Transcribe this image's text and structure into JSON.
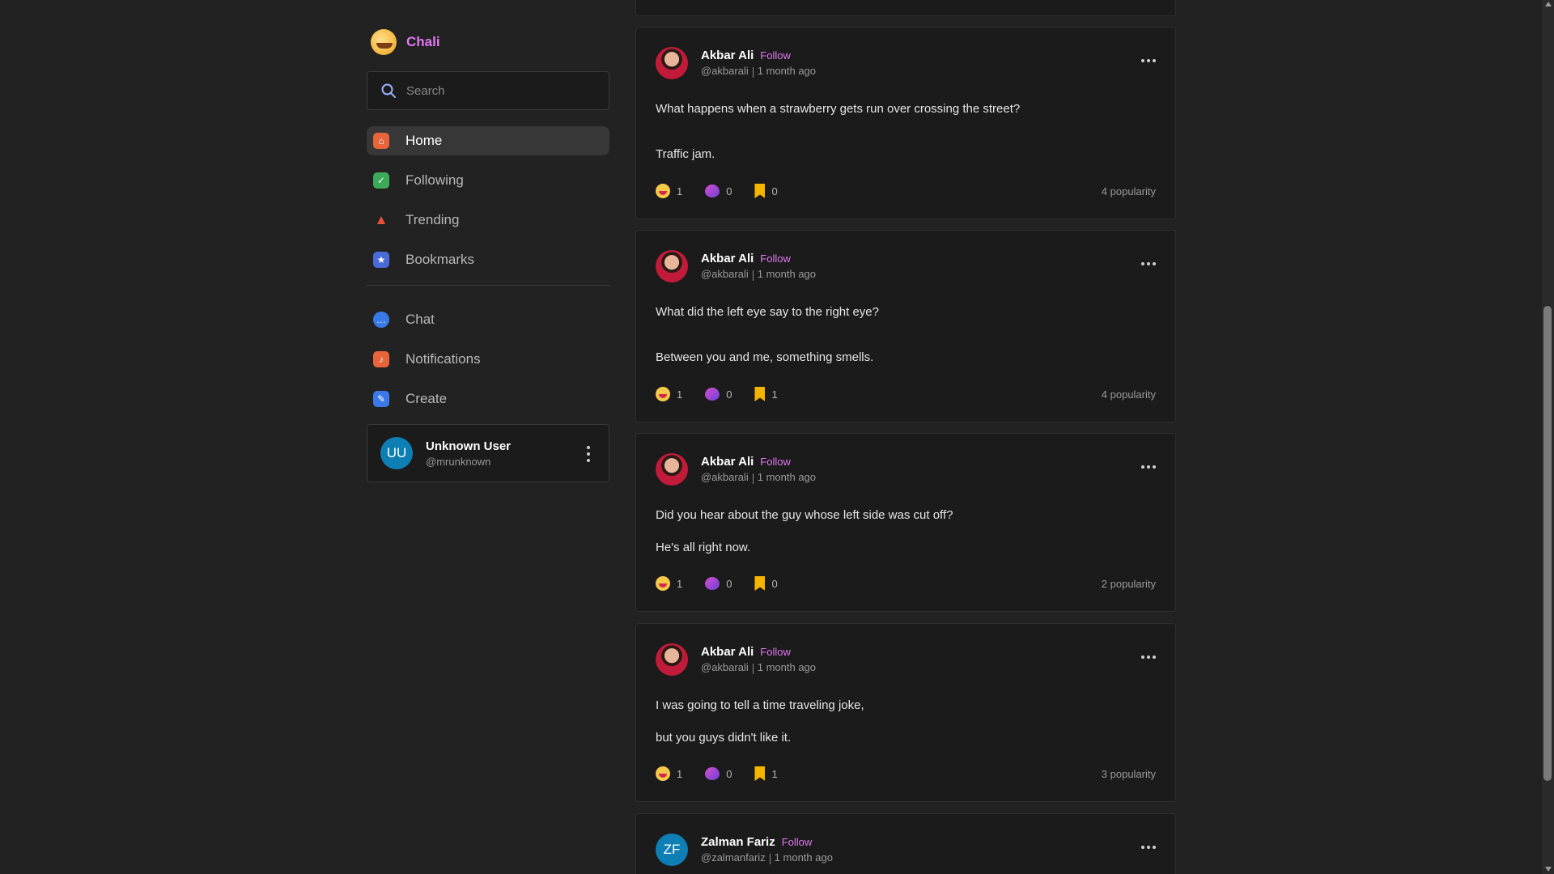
{
  "brand": {
    "name": "Chali"
  },
  "search": {
    "placeholder": "Search"
  },
  "nav": {
    "items": [
      {
        "label": "Home",
        "icon": "home-icon",
        "color": "#e8643a",
        "active": true
      },
      {
        "label": "Following",
        "icon": "check-icon",
        "color": "#3daa5a"
      },
      {
        "label": "Trending",
        "icon": "fire-icon",
        "color": "#e8503a"
      },
      {
        "label": "Bookmarks",
        "icon": "bookmark-star-icon",
        "color": "#4a6ad8"
      }
    ],
    "secondary": [
      {
        "label": "Chat",
        "icon": "chat-icon",
        "color": "#3a7ae8"
      },
      {
        "label": "Notifications",
        "icon": "bell-icon",
        "color": "#e8643a"
      },
      {
        "label": "Create",
        "icon": "pencil-icon",
        "color": "#3a7ae8"
      }
    ]
  },
  "current_user": {
    "initials": "UU",
    "name": "Unknown User",
    "handle": "@mrunknown"
  },
  "posts": [
    {
      "author": "Akbar Ali",
      "follow": "Follow",
      "handle": "@akbarali",
      "time": "1 month ago",
      "lines": [
        "What happens when a strawberry gets run over crossing the street?",
        "Traffic jam."
      ],
      "laughs": "1",
      "comments": "0",
      "bookmarks": "0",
      "popularity": "4 popularity"
    },
    {
      "author": "Akbar Ali",
      "follow": "Follow",
      "handle": "@akbarali",
      "time": "1 month ago",
      "lines": [
        "What did the left eye say to the right eye?",
        "Between you and me, something smells."
      ],
      "laughs": "1",
      "comments": "0",
      "bookmarks": "1",
      "popularity": "4 popularity"
    },
    {
      "author": "Akbar Ali",
      "follow": "Follow",
      "handle": "@akbarali",
      "time": "1 month ago",
      "lines": [
        "Did you hear about the guy whose left side was cut off?",
        "He's all right now."
      ],
      "laughs": "1",
      "comments": "0",
      "bookmarks": "0",
      "popularity": "2 popularity"
    },
    {
      "author": "Akbar Ali",
      "follow": "Follow",
      "handle": "@akbarali",
      "time": "1 month ago",
      "lines": [
        "I was going to tell a time traveling joke,",
        "but you guys didn't like it."
      ],
      "laughs": "1",
      "comments": "0",
      "bookmarks": "1",
      "popularity": "3 popularity"
    },
    {
      "author": "Zalman Fariz",
      "initials": "ZF",
      "follow": "Follow",
      "handle": "@zalmanfariz",
      "time": "1 month ago"
    }
  ]
}
